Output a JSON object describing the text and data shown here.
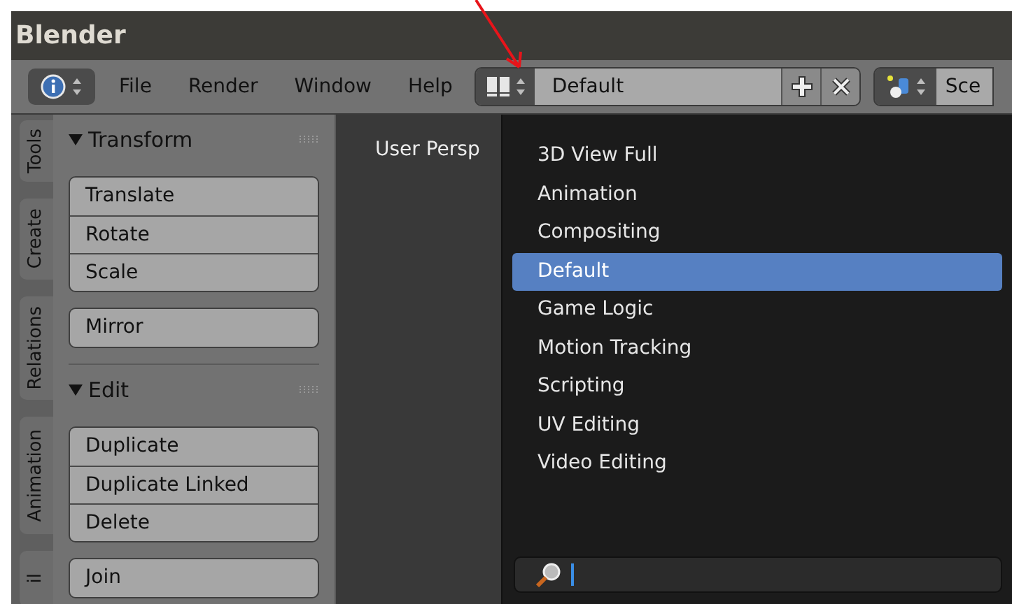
{
  "window": {
    "title": "Blender"
  },
  "header": {
    "menus": [
      "File",
      "Render",
      "Window",
      "Help"
    ],
    "layout": {
      "value": "Default"
    },
    "scene": {
      "value": "Sce"
    }
  },
  "side_tabs": [
    {
      "label": "Tools"
    },
    {
      "label": "Create"
    },
    {
      "label": "Relations"
    },
    {
      "label": "Animation"
    },
    {
      "label": "il"
    }
  ],
  "panels": [
    {
      "title": "Transform",
      "groups": [
        [
          "Translate",
          "Rotate",
          "Scale"
        ],
        [
          "Mirror"
        ]
      ]
    },
    {
      "title": "Edit",
      "groups": [
        [
          "Duplicate",
          "Duplicate Linked",
          "Delete"
        ],
        [
          "Join"
        ]
      ]
    }
  ],
  "viewport": {
    "label": "User Persp"
  },
  "layout_menu": {
    "items": [
      {
        "label": "3D View Full",
        "selected": false
      },
      {
        "label": "Animation",
        "selected": false
      },
      {
        "label": "Compositing",
        "selected": false
      },
      {
        "label": "Default",
        "selected": true
      },
      {
        "label": "Game Logic",
        "selected": false
      },
      {
        "label": "Motion Tracking",
        "selected": false
      },
      {
        "label": "Scripting",
        "selected": false
      },
      {
        "label": "UV Editing",
        "selected": false
      },
      {
        "label": "Video Editing",
        "selected": false
      }
    ]
  }
}
